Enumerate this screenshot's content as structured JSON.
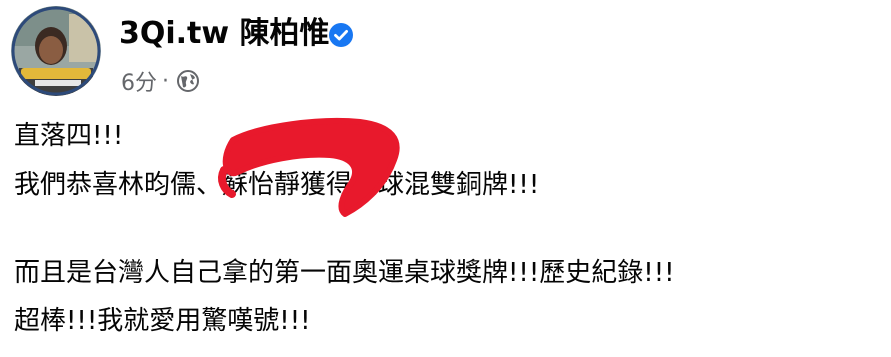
{
  "post": {
    "author": "3Qi.tw 陳柏惟",
    "time": "6分",
    "separator": "·",
    "privacy_icon": "globe-icon",
    "verified_icon": "verified-badge-icon",
    "lines": [
      "直落四!!!",
      "我們恭喜林昀儒、蘇怡靜獲得桌球混雙銅牌!!!",
      "而且是台灣人自己拿的第一面奧運桌球獎牌!!!歷史紀錄!!!",
      "超棒!!!我就愛用驚嘆號!!!"
    ]
  },
  "colors": {
    "verified": "#1877f2",
    "meta_text": "#65676b",
    "annotation": "#e8192c"
  }
}
